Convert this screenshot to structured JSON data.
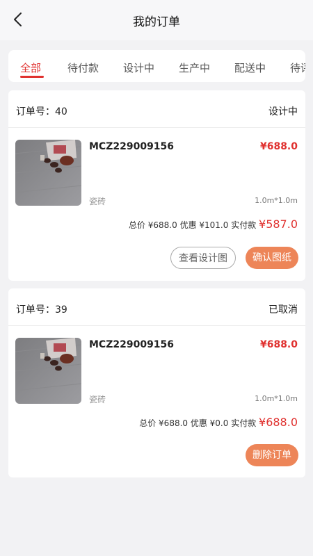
{
  "header": {
    "title": "我的订单"
  },
  "tabs": [
    "全部",
    "待付款",
    "设计中",
    "生产中",
    "配送中",
    "待评"
  ],
  "orders": [
    {
      "order_no_label": "订单号：40",
      "status": "设计中",
      "sku": "MCZ229009156",
      "price": "¥688.0",
      "material": "瓷砖",
      "spec": "1.0m*1.0m",
      "summary_prefix": "总价 ¥688.0  优惠 ¥101.0  实付款 ",
      "real_price": "¥587.0",
      "buttons": [
        "查看设计图",
        "确认图纸"
      ]
    },
    {
      "order_no_label": "订单号：39",
      "status": "已取消",
      "sku": "MCZ229009156",
      "price": "¥688.0",
      "material": "瓷砖",
      "spec": "1.0m*1.0m",
      "summary_prefix": "总价 ¥688.0  优惠 ¥0.0  实付款 ",
      "real_price": "¥688.0",
      "buttons": [
        "删除订单"
      ]
    }
  ],
  "colors": {
    "accent": "#e0312f",
    "button": "#ed8558",
    "background": "#f2f2f4"
  }
}
